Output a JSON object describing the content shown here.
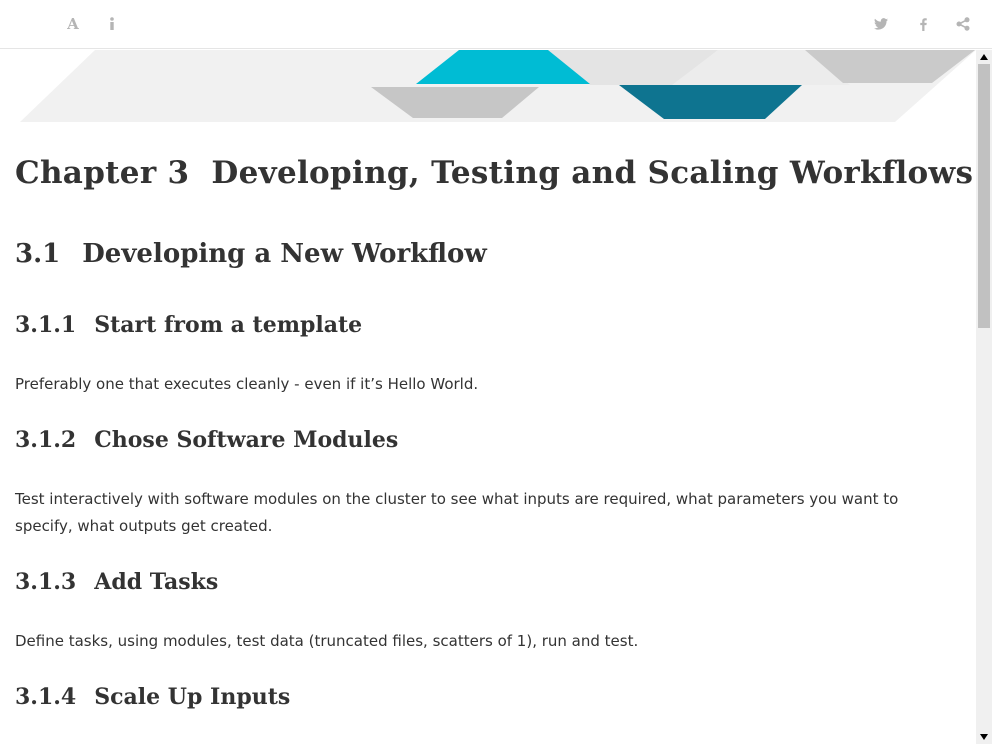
{
  "toolbar": {
    "font_icon_glyph": "A",
    "info_icon_glyph": "i"
  },
  "colors": {
    "accent_cyan": "#00bcd4",
    "accent_teal": "#0e7490",
    "banner_gray": "#c8c8c8",
    "banner_light": "#e8e8e8"
  },
  "article": {
    "chapter": {
      "number": "Chapter 3",
      "title": "Developing, Testing and Scaling Workflows"
    },
    "section": {
      "number": "3.1",
      "title": "Developing a New Workflow"
    },
    "subsections": [
      {
        "number": "3.1.1",
        "title": "Start from a template",
        "text": "Preferably one that executes cleanly - even if it’s Hello World."
      },
      {
        "number": "3.1.2",
        "title": "Chose Software Modules",
        "text": "Test interactively with software modules on the cluster to see what inputs are required, what parameters you want to specify, what outputs get created."
      },
      {
        "number": "3.1.3",
        "title": "Add Tasks",
        "text": "Define tasks, using modules, test data (truncated files, scatters of 1), run and test."
      },
      {
        "number": "3.1.4",
        "title": "Scale Up Inputs",
        "text": ""
      }
    ]
  }
}
